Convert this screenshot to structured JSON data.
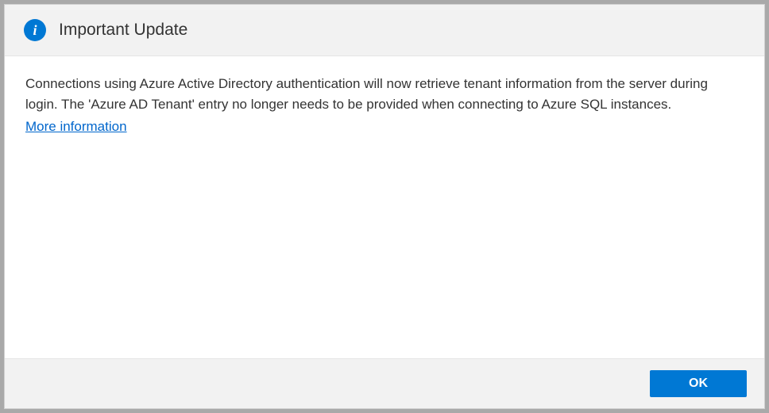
{
  "header": {
    "title": "Important Update",
    "icon": "info-icon"
  },
  "content": {
    "message": "Connections using Azure Active Directory authentication will now retrieve tenant information from the server during login. The 'Azure AD Tenant' entry no longer needs to be provided when connecting to Azure SQL instances.",
    "link_label": "More information"
  },
  "footer": {
    "ok_label": "OK"
  },
  "colors": {
    "accent": "#0078d4",
    "link": "#0066cc",
    "header_bg": "#f2f2f2",
    "footer_bg": "#f2f2f2"
  }
}
